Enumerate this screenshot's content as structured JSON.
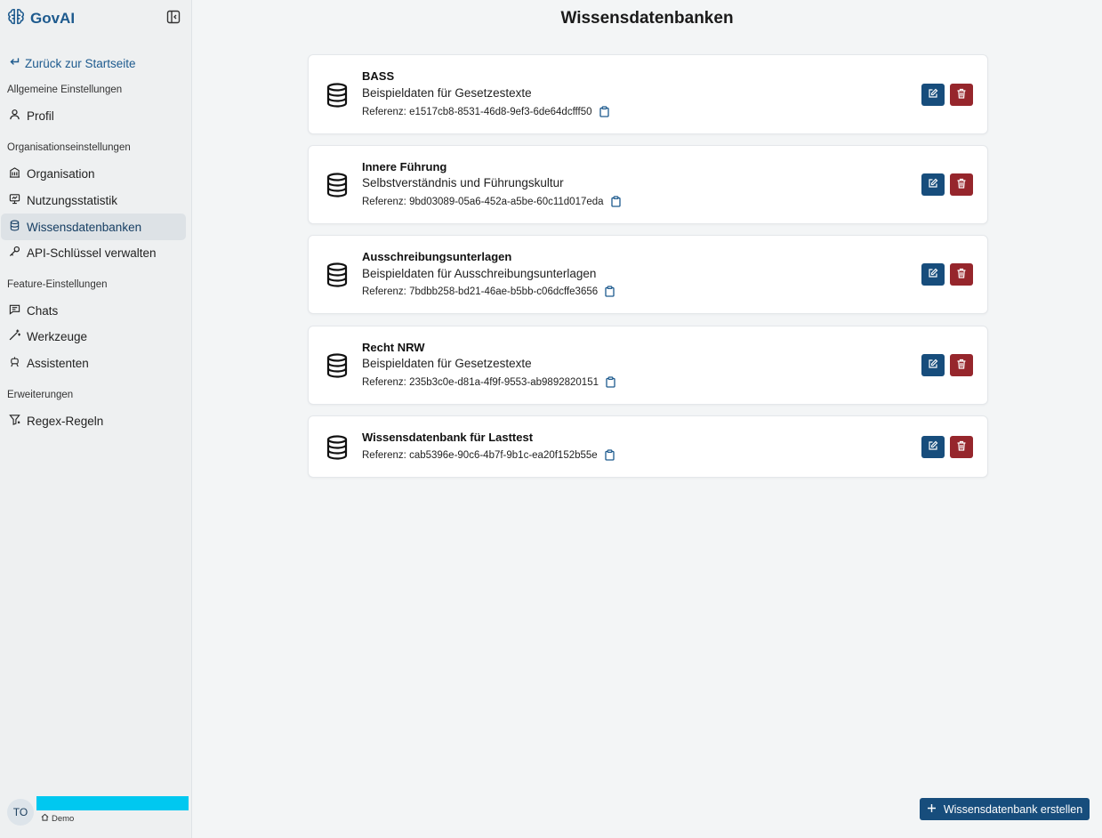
{
  "app": {
    "name": "GovAI",
    "logo_icon": "brain-icon",
    "accent_color": "#174d7c",
    "danger_color": "#96262c"
  },
  "sidebar": {
    "back_label": "Zurück zur Startseite",
    "sections": [
      {
        "title": "Allgemeine Einstellungen",
        "items": [
          {
            "label": "Profil",
            "icon": "user-icon"
          }
        ]
      },
      {
        "title": "Organisationseinstellungen",
        "items": [
          {
            "label": "Organisation",
            "icon": "building-icon"
          },
          {
            "label": "Nutzungsstatistik",
            "icon": "presentation-chart-icon"
          },
          {
            "label": "Wissensdatenbanken",
            "icon": "database-icon",
            "active": true
          },
          {
            "label": "API-Schlüssel verwalten",
            "icon": "key-icon"
          }
        ]
      },
      {
        "title": "Feature-Einstellungen",
        "items": [
          {
            "label": "Chats",
            "icon": "chat-icon"
          },
          {
            "label": "Werkzeuge",
            "icon": "magic-wand-icon"
          },
          {
            "label": "Assistenten",
            "icon": "bot-icon"
          }
        ]
      },
      {
        "title": "Erweiterungen",
        "items": [
          {
            "label": "Regex-Regeln",
            "icon": "filter-icon"
          }
        ]
      }
    ]
  },
  "user": {
    "initials": "TO",
    "org": "Demo"
  },
  "main": {
    "title": "Wissensdatenbanken",
    "reference_prefix": "Referenz:",
    "knowledge_bases": [
      {
        "name": "BASS",
        "description": "Beispieldaten für Gesetzestexte",
        "reference": "e1517cb8-8531-46d8-9ef3-6de64dcfff50"
      },
      {
        "name": "Innere Führung",
        "description": "Selbstverständnis und Führungskultur",
        "reference": "9bd03089-05a6-452a-a5be-60c11d017eda"
      },
      {
        "name": "Ausschreibungsunterlagen",
        "description": "Beispieldaten für Ausschreibungsunterlagen",
        "reference": "7bdbb258-bd21-46ae-b5bb-c06dcffe3656"
      },
      {
        "name": "Recht NRW",
        "description": "Beispieldaten für Gesetzestexte",
        "reference": "235b3c0e-d81a-4f9f-9553-ab9892820151"
      },
      {
        "name": "Wissensdatenbank für Lasttest",
        "description": "",
        "reference": "cab5396e-90c6-4b7f-9b1c-ea20f152b55e"
      }
    ],
    "create_button": "Wissensdatenbank erstellen"
  }
}
